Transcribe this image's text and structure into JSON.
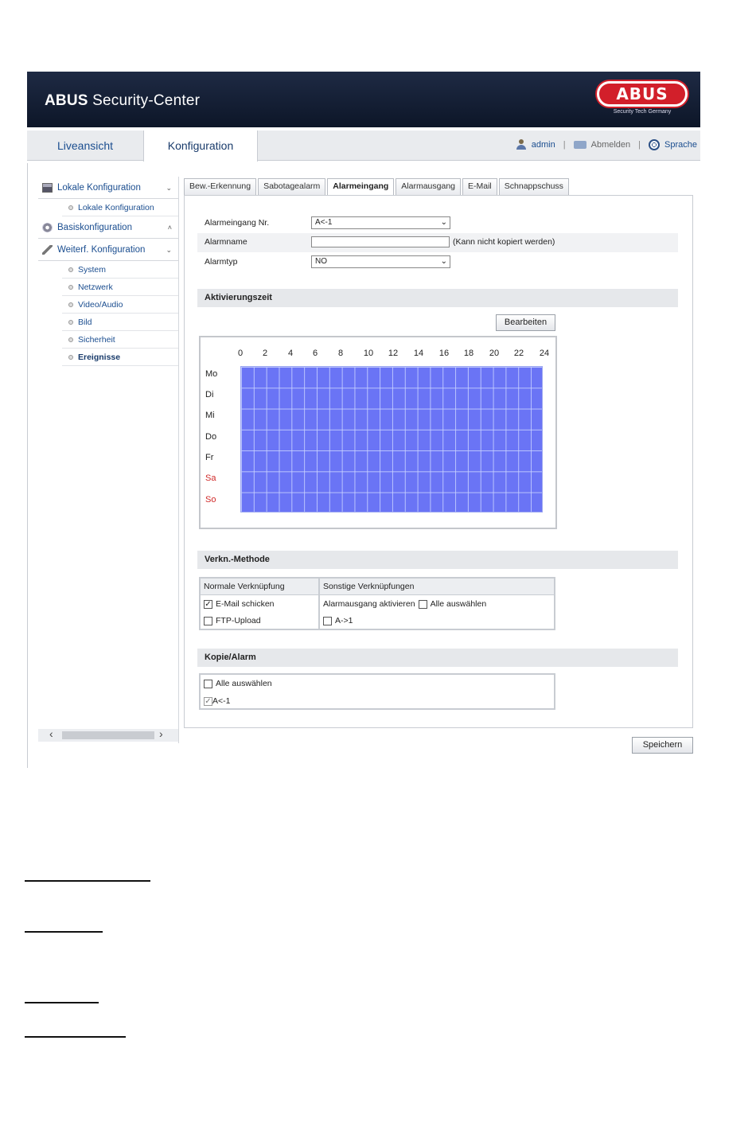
{
  "header": {
    "brand_bold": "ABUS",
    "brand_rest": " Security-Center",
    "logo_text": "ABUS",
    "logo_tagline": "Security Tech Germany"
  },
  "topnav": {
    "tabs": [
      "Liveansicht",
      "Konfiguration"
    ],
    "user": "admin",
    "logout": "Abmelden",
    "language": "Sprache",
    "separator": "|"
  },
  "sidebar": {
    "local": {
      "label": "Lokale Konfiguration",
      "chevron": "⌄",
      "items": [
        "Lokale Konfiguration"
      ]
    },
    "basic": {
      "label": "Basiskonfiguration",
      "chevron": "˄"
    },
    "advanced": {
      "label": "Weiterf. Konfiguration",
      "chevron": "⌄",
      "items": [
        "System",
        "Netzwerk",
        "Video/Audio",
        "Bild",
        "Sicherheit",
        "Ereignisse"
      ]
    },
    "scroll_left": "‹",
    "scroll_right": "›"
  },
  "tabs": [
    "Bew.-Erkennung",
    "Sabotagealarm",
    "Alarmeingang",
    "Alarmausgang",
    "E-Mail",
    "Schnappschuss"
  ],
  "form": {
    "input_no_label": "Alarmeingang Nr.",
    "input_no_value": "A<-1",
    "name_label": "Alarmname",
    "name_value": "",
    "name_note": "(Kann nicht kopiert werden)",
    "type_label": "Alarmtyp",
    "type_value": "NO"
  },
  "activation": {
    "title": "Aktivierungszeit",
    "edit_button": "Bearbeiten",
    "hours": [
      "0",
      "2",
      "4",
      "6",
      "8",
      "10",
      "12",
      "14",
      "16",
      "18",
      "20",
      "22",
      "24"
    ],
    "days": [
      "Mo",
      "Di",
      "Mi",
      "Do",
      "Fr",
      "Sa",
      "So"
    ],
    "weekend_color": "#d02a2a",
    "schedule_color": "#6a74f5"
  },
  "linkage": {
    "title": "Verkn.-Methode",
    "normal_header": "Normale Verknüpfung",
    "other_header": "Sonstige Verknüpfungen",
    "email": "E-Mail schicken",
    "email_checked": "✓",
    "ftp": "FTP-Upload",
    "alarm_out": "Alarmausgang aktivieren",
    "select_all": "Alle auswählen",
    "output": "A->1"
  },
  "copy": {
    "title": "Kopie/Alarm",
    "select_all": "Alle auswählen",
    "item": "A<-1",
    "item_checked": "✓"
  },
  "save_button": "Speichern"
}
